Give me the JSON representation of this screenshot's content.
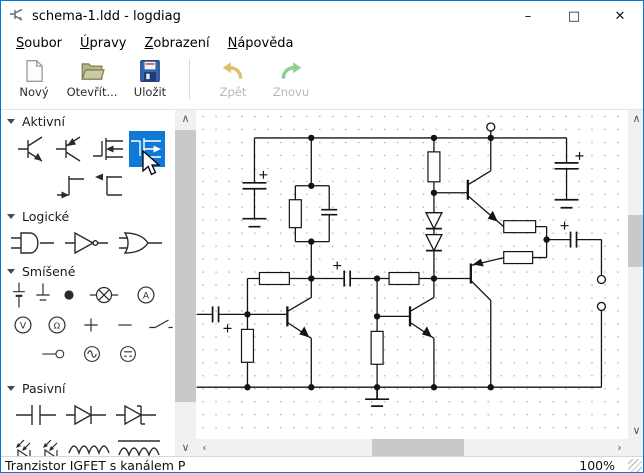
{
  "window": {
    "title": "schema-1.ldd - logdiag",
    "icon": "logdiag-app-icon",
    "controls": {
      "minimize": "–",
      "maximize": "□",
      "close": "✕"
    }
  },
  "menu": {
    "items": [
      {
        "accel": "S",
        "rest": "oubor"
      },
      {
        "accel": "Ú",
        "rest": "pravy"
      },
      {
        "accel": "Z",
        "rest": "obrazení"
      },
      {
        "accel": "N",
        "rest": "ápověda"
      }
    ]
  },
  "toolbar": {
    "buttons": [
      {
        "label": "Nový",
        "icon": "new-document-icon",
        "enabled": true
      },
      {
        "label": "Otevřít...",
        "icon": "open-folder-icon",
        "enabled": true
      },
      {
        "label": "Uložit",
        "icon": "save-floppy-icon",
        "enabled": true
      },
      {
        "label": "Zpět",
        "icon": "undo-arrow-icon",
        "enabled": false
      },
      {
        "label": "Znovu",
        "icon": "redo-arrow-icon",
        "enabled": false
      }
    ]
  },
  "palette": {
    "selected_tool": "igfet-p-transistor",
    "sections": [
      {
        "label": "Aktivní",
        "icons": [
          "npn-transistor-icon",
          "pnp-transistor-icon",
          "igfet-n-transistor-icon",
          "igfet-p-transistor-icon",
          "jfet-n-transistor-icon",
          "jfet-p-transistor-icon"
        ]
      },
      {
        "label": "Logické",
        "icons": [
          "and-gate-icon",
          "not-gate-icon",
          "or-gate-icon"
        ]
      },
      {
        "label": "Smíšené",
        "icons": [
          "cell-icon",
          "ground-icon",
          "junction-icon",
          "lamp-icon",
          "ammeter-icon",
          "voltmeter-icon",
          "ohmmeter-icon",
          "plus-icon",
          "minus-icon",
          "switch-icon",
          "terminal-icon",
          "ac-source-icon",
          "dc-source-icon"
        ]
      },
      {
        "label": "Pasivní",
        "icons": [
          "capacitor-icon",
          "diode-icon",
          "zener-diode-icon",
          "led-icon",
          "led-icon-2",
          "inductor-icon",
          "inductor-core-icon"
        ]
      }
    ],
    "meters": {
      "ammeter": "A",
      "voltmeter": "V",
      "ohmmeter": "Ω"
    }
  },
  "scrollbars": {
    "up": "∧",
    "down": "∨",
    "left": "‹",
    "right": "›"
  },
  "statusbar": {
    "message": "Tranzistor IGFET s kanálem P",
    "zoom": "100%"
  },
  "colors": {
    "accent": "#0078d7",
    "selection": "#0e7ad6",
    "canvas_dot": "#a9a9a9",
    "disabled_text": "#b9b9b9"
  }
}
